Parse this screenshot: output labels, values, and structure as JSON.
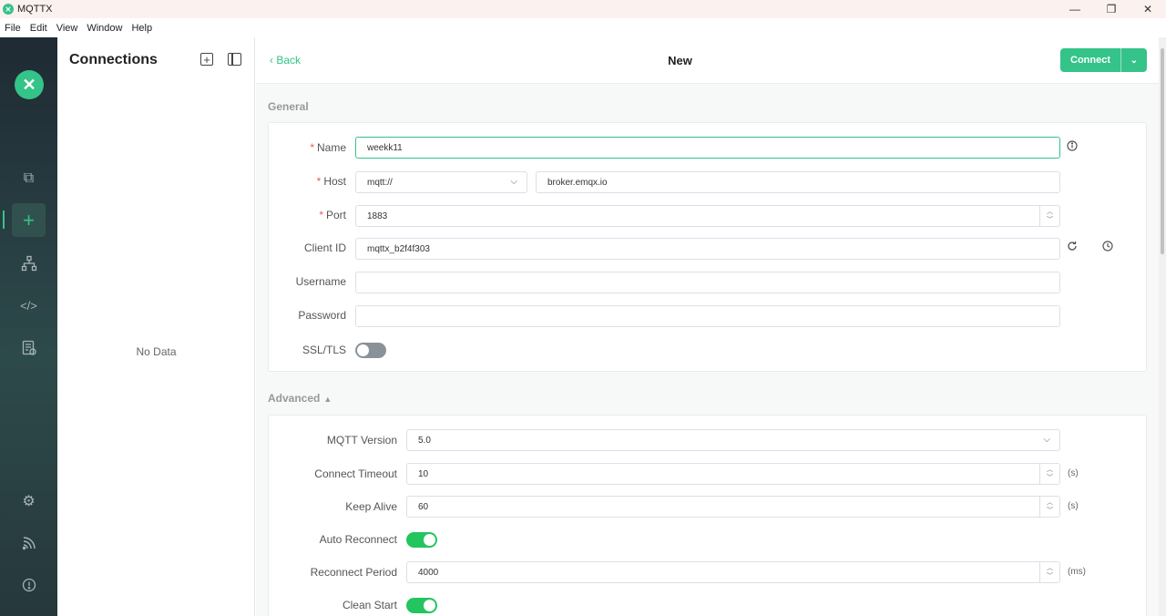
{
  "window": {
    "title": "MQTTX",
    "minimize": "—",
    "maximize": "❐",
    "close": "✕"
  },
  "menu": [
    "File",
    "Edit",
    "View",
    "Window",
    "Help"
  ],
  "connections": {
    "title": "Connections",
    "empty": "No Data"
  },
  "header": {
    "back": "Back",
    "title": "New",
    "connect": "Connect"
  },
  "general": {
    "label": "General",
    "name": {
      "label": "Name",
      "value": "weekk11"
    },
    "host": {
      "label": "Host",
      "protocol": "mqtt://",
      "value": "broker.emqx.io"
    },
    "port": {
      "label": "Port",
      "value": "1883"
    },
    "client_id": {
      "label": "Client ID",
      "value": "mqttx_b2f4f303"
    },
    "username": {
      "label": "Username",
      "value": ""
    },
    "password": {
      "label": "Password",
      "value": ""
    },
    "ssl": {
      "label": "SSL/TLS",
      "enabled": false
    }
  },
  "advanced": {
    "label": "Advanced",
    "mqtt_version": {
      "label": "MQTT Version",
      "value": "5.0"
    },
    "connect_timeout": {
      "label": "Connect Timeout",
      "value": "10",
      "unit": "(s)"
    },
    "keep_alive": {
      "label": "Keep Alive",
      "value": "60",
      "unit": "(s)"
    },
    "auto_reconnect": {
      "label": "Auto Reconnect",
      "enabled": true
    },
    "reconnect_period": {
      "label": "Reconnect Period",
      "value": "4000",
      "unit": "(ms)"
    },
    "clean_start": {
      "label": "Clean Start",
      "enabled": true
    }
  },
  "colors": {
    "accent": "#34c388",
    "toggle_on": "#22c55e",
    "required": "#ea5a5a"
  }
}
